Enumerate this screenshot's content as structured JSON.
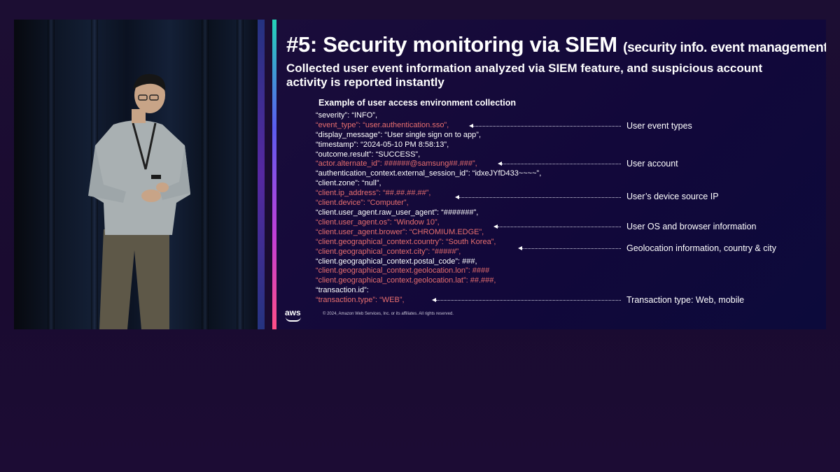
{
  "slide": {
    "title_main": "#5: Security monitoring via SIEM",
    "title_note": "(security info. event management)",
    "subtitle": "Collected user event information analyzed via SIEM feature, and suspicious account activity is reported instantly",
    "section_heading": "Example of user access environment collection",
    "code_lines": [
      {
        "text": "“severity”: “INFO”,",
        "highlight": false
      },
      {
        "text": "“event_type”: “user.authentication.sso”,",
        "highlight": true
      },
      {
        "text": "“display_message”: “User single sign on to app”,",
        "highlight": false
      },
      {
        "text": "“timestamp”: “2024-05-10 PM 8:58:13”,",
        "highlight": false
      },
      {
        "text": "“outcome.result”: “SUCCESS”,",
        "highlight": false
      },
      {
        "text": "“actor.alternate_id”: ######@samsung##.###”,",
        "highlight": true
      },
      {
        "text": "“authentication_context.external_session_id”: “idxeJYfD433~~~~”,",
        "highlight": false
      },
      {
        "text": "“client.zone”: “null”,",
        "highlight": false
      },
      {
        "text": "“client.ip_address”: “##.##.##.##”,",
        "highlight": true
      },
      {
        "text": "“client.device”: “Computer”,",
        "highlight": true
      },
      {
        "text": "“client.user_agent.raw_user_agent”: “#######”,",
        "highlight": false
      },
      {
        "text": "“client.user_agent.os”: “Window 10”,",
        "highlight": true
      },
      {
        "text": "“client.user_agent.brower”: “CHROMIUM.EDGE”,",
        "highlight": true
      },
      {
        "text": "“client.geographical_context.country”: “South Korea”,",
        "highlight": true
      },
      {
        "text": "“client.geographical_context.city”: “#####”,",
        "highlight": true
      },
      {
        "text": "“client.geographical_context.postal_code”: ###,",
        "highlight": false
      },
      {
        "text": "“client.geographical_context.geolocation.lon”: ####",
        "highlight": true
      },
      {
        "text": "“client.geographical_context.geolocation.lat”: ##.###,",
        "highlight": true
      },
      {
        "text": "“transaction.id”:",
        "highlight": false
      },
      {
        "text": "“transaction.type”: “WEB”,",
        "highlight": true
      }
    ],
    "annotations": [
      "User event types",
      "User account",
      "User’s device source IP",
      "User OS and browser information",
      "Geolocation information, country & city",
      "Transaction type: Web, mobile"
    ],
    "logo_text": "aws",
    "copyright": "© 2024, Amazon Web Services, Inc. or its affiliates. All rights reserved."
  },
  "colors": {
    "highlight_text": "#e86e6e",
    "normal_text": "#ffffff",
    "slide_background": "#140a3a",
    "page_background": "#1c0e33"
  }
}
